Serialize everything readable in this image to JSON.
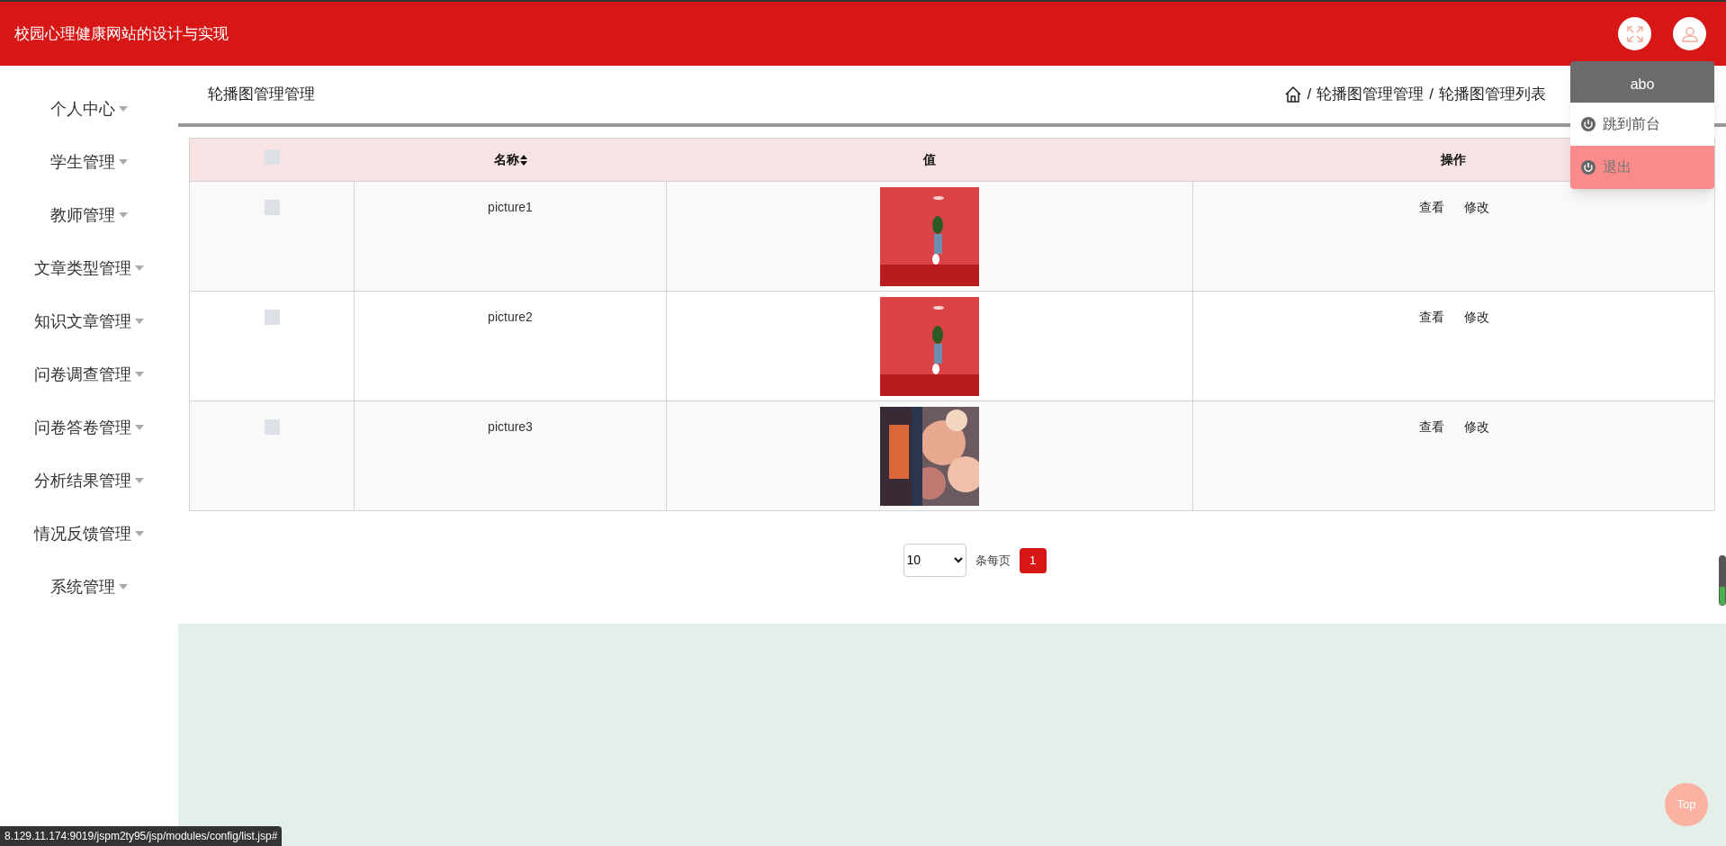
{
  "header": {
    "title": "校园心理健康网站的设计与实现"
  },
  "user_menu": {
    "username": "abo",
    "items": [
      {
        "label": "跳到前台",
        "selected": false
      },
      {
        "label": "退出",
        "selected": true
      }
    ]
  },
  "sidebar": {
    "items": [
      {
        "label": "个人中心",
        "expanded": false
      },
      {
        "label": "学生管理",
        "expanded": false
      },
      {
        "label": "教师管理",
        "expanded": false
      },
      {
        "label": "文章类型管理",
        "expanded": false
      },
      {
        "label": "知识文章管理",
        "expanded": false
      },
      {
        "label": "问卷调查管理",
        "expanded": false
      },
      {
        "label": "问卷答卷管理",
        "expanded": false
      },
      {
        "label": "分析结果管理",
        "expanded": false
      },
      {
        "label": "情况反馈管理",
        "expanded": false
      },
      {
        "label": "系统管理",
        "expanded": false
      }
    ]
  },
  "page": {
    "title": "轮播图管理管理",
    "breadcrumb": [
      "轮播图管理管理",
      "轮播图管理列表"
    ],
    "breadcrumb_separator": "/"
  },
  "table": {
    "header_checked": false,
    "columns": [
      {
        "label": "名称",
        "sortable": true
      },
      {
        "label": "值",
        "sortable": false
      },
      {
        "label": "操作",
        "sortable": false
      }
    ],
    "rows": [
      {
        "checked": false,
        "name": "picture1",
        "value": {
          "kind": "picture"
        },
        "actions": [
          "查看",
          "修改"
        ]
      },
      {
        "checked": false,
        "name": "picture2",
        "value": {
          "kind": "picture"
        },
        "actions": [
          "查看",
          "修改"
        ]
      },
      {
        "checked": false,
        "name": "picture3",
        "value": {
          "kind": "picture"
        },
        "actions": [
          "查看",
          "修改"
        ]
      }
    ]
  },
  "pagination": {
    "page_size": "10",
    "page_size_label": "条每页",
    "pages": [
      {
        "label": "1",
        "selected": true
      }
    ]
  },
  "back_to_top": "Top",
  "status_url": "8.129.11.174:9019/jspm2ty95/jsp/modules/config/list.jsp#"
}
